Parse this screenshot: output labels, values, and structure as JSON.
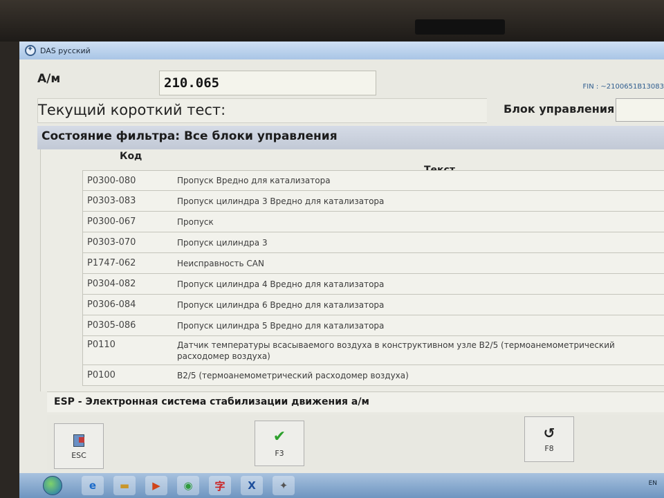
{
  "window": {
    "title": "DAS русский"
  },
  "header": {
    "am_label": "А/м",
    "am_value": "210.065",
    "fin": "FIN : ~2100651B13083",
    "short_test_label": "Текущий короткий тест:",
    "unit_label": "Блок управления",
    "unit_value": ""
  },
  "filter": {
    "label": "Состояние фильтра: Все блоки управления"
  },
  "table": {
    "col_code": "Код",
    "col_text": "Текст",
    "rows": [
      {
        "code": "P0300-080",
        "text": "Пропуск Вредно для катализатора"
      },
      {
        "code": "P0303-083",
        "text": "Пропуск цилиндра 3 Вредно для катализатора"
      },
      {
        "code": "P0300-067",
        "text": "Пропуск"
      },
      {
        "code": "P0303-070",
        "text": "Пропуск цилиндра 3"
      },
      {
        "code": "P1747-062",
        "text": "Неисправность CAN"
      },
      {
        "code": "P0304-082",
        "text": "Пропуск цилиндра 4 Вредно для катализатора"
      },
      {
        "code": "P0306-084",
        "text": "Пропуск цилиндра 6 Вредно для катализатора"
      },
      {
        "code": "P0305-086",
        "text": "Пропуск цилиндра 5 Вредно для катализатора"
      },
      {
        "code": "P0110",
        "text": "Датчик температуры всасываемого воздуха в конструктивном узле B2/5 (термоанемометрический расходомер воздуха)"
      },
      {
        "code": "P0100",
        "text": "B2/5 (термоанемометрический расходомер воздуха)"
      }
    ]
  },
  "esp": {
    "label": "ESP - Электронная система стабилизации движения а/м"
  },
  "buttons": {
    "esc": {
      "label": "ESC",
      "icon": "exit-icon"
    },
    "f3": {
      "label": "F3",
      "icon": "check-icon"
    },
    "f8": {
      "label": "F8",
      "icon": "back-arrow-icon"
    }
  },
  "taskbar": {
    "tray_lang": "EN"
  }
}
